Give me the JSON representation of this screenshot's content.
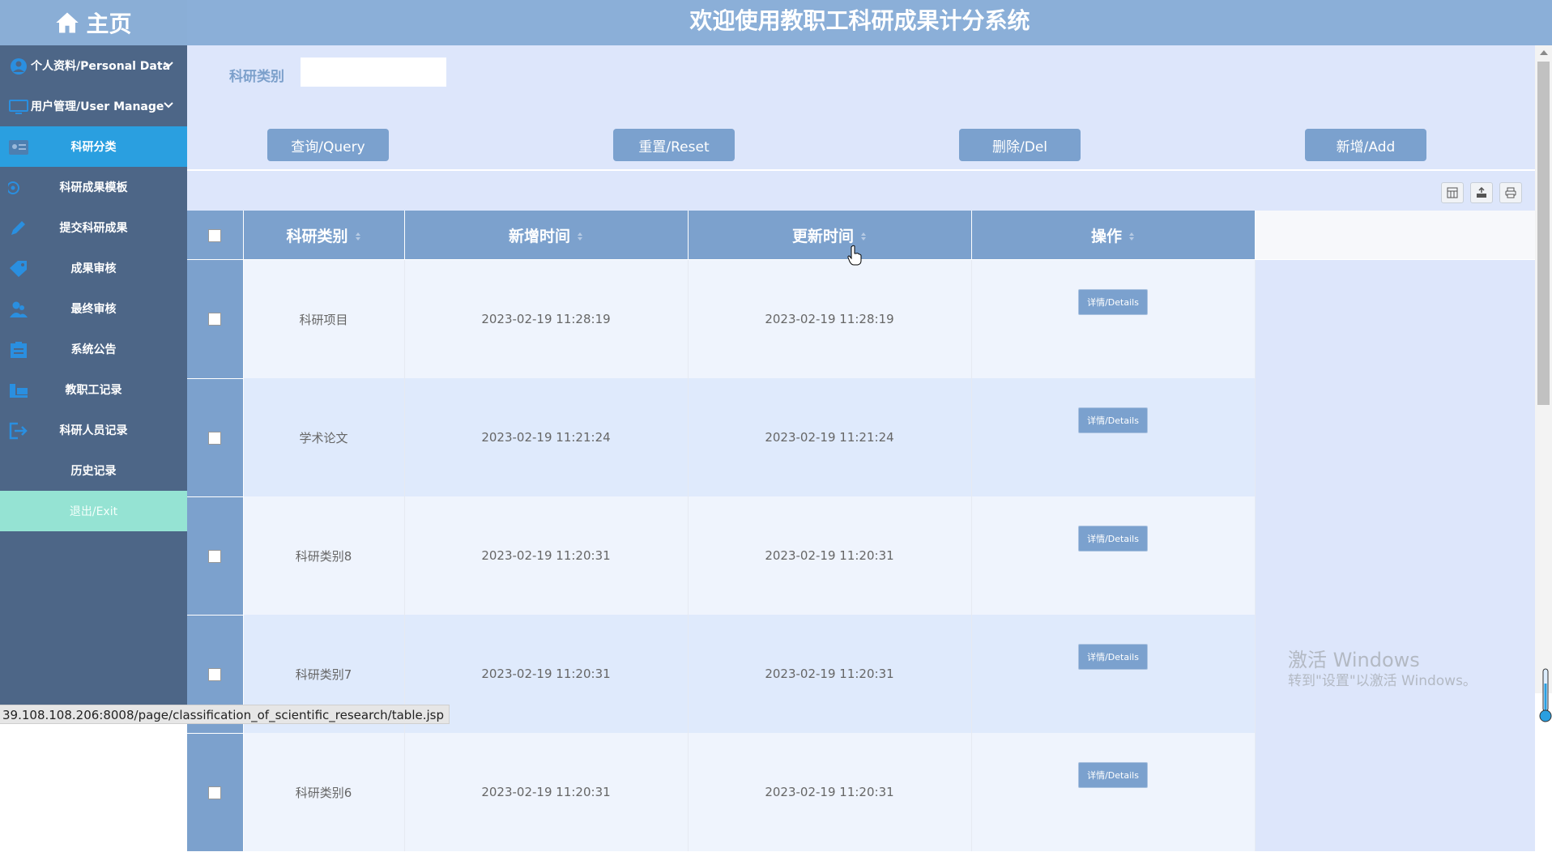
{
  "home": {
    "label": "主页",
    "icon": "home-icon"
  },
  "app_title": "欢迎使用教职工科研成果计分系统",
  "sidebar": {
    "items": [
      {
        "label": "个人资料/Personal Data",
        "icon": "user-circle-icon"
      },
      {
        "label": "用户管理/User Manage",
        "icon": "monitor-icon"
      },
      {
        "label": "科研分类",
        "icon": "id-card-icon"
      },
      {
        "label": "科研成果模板",
        "icon": "settings-icon"
      },
      {
        "label": "提交科研成果",
        "icon": "pen-icon"
      },
      {
        "label": "成果审核",
        "icon": "tag-icon"
      },
      {
        "label": "最终审核",
        "icon": "user-group-icon"
      },
      {
        "label": "系统公告",
        "icon": "clipboard-icon"
      },
      {
        "label": "教职工记录",
        "icon": "bed-icon"
      },
      {
        "label": "科研人员记录",
        "icon": "logout-icon"
      },
      {
        "label": "历史记录",
        "icon": ""
      },
      {
        "label": "退出/Exit",
        "icon": ""
      }
    ]
  },
  "search": {
    "label": "科研类别",
    "value": ""
  },
  "buttons": {
    "query": "查询/Query",
    "reset": "重置/Reset",
    "delete": "删除/Del",
    "add": "新增/Add"
  },
  "toolbar_icons": [
    "columns-icon",
    "export-icon",
    "print-icon"
  ],
  "table": {
    "headers": [
      "科研类别",
      "新增时间",
      "更新时间",
      "操作"
    ],
    "rows": [
      {
        "category": "科研项目",
        "created": "2023-02-19 11:28:19",
        "updated": "2023-02-19 11:28:19",
        "action": "详情/Details"
      },
      {
        "category": "学术论文",
        "created": "2023-02-19 11:21:24",
        "updated": "2023-02-19 11:21:24",
        "action": "详情/Details"
      },
      {
        "category": "科研类别8",
        "created": "2023-02-19 11:20:31",
        "updated": "2023-02-19 11:20:31",
        "action": "详情/Details"
      },
      {
        "category": "科研类别7",
        "created": "2023-02-19 11:20:31",
        "updated": "2023-02-19 11:20:31",
        "action": "详情/Details"
      },
      {
        "category": "科研类别6",
        "created": "2023-02-19 11:20:31",
        "updated": "2023-02-19 11:20:31",
        "action": "详情/Details"
      }
    ]
  },
  "watermark": {
    "line1": "激活 Windows",
    "line2": "转到\"设置\"以激活 Windows。"
  },
  "status_url": "39.108.108.206:8008/page/classification_of_scientific_research/table.jsp",
  "colors": {
    "header": "#8bafd8",
    "sidebar": "#4d6687",
    "active": "#2a9fe0",
    "exit": "#95e3d3",
    "button": "#7ba1ce",
    "main_bg": "#dde6fb"
  }
}
